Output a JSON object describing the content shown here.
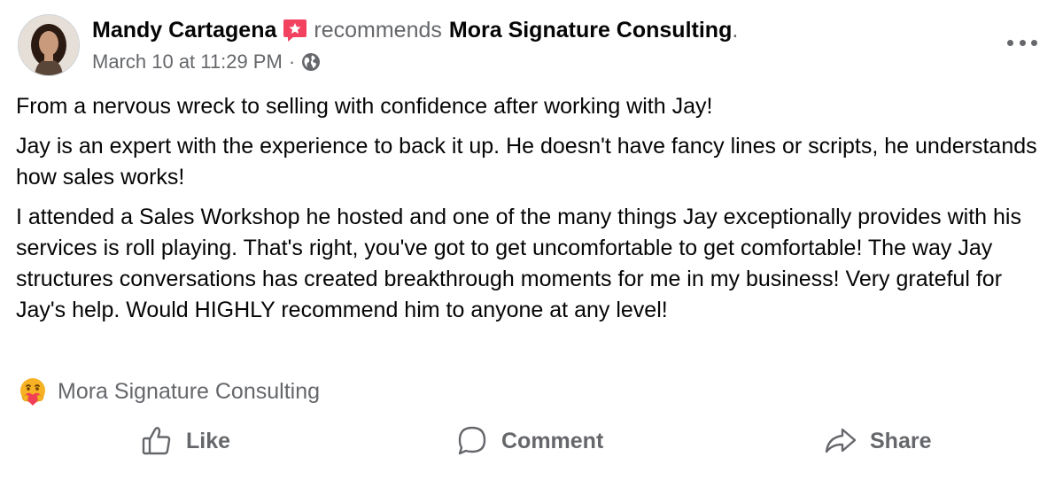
{
  "post": {
    "author": "Mandy Cartagena",
    "action_text": "recommends",
    "page_name": "Mora Signature Consulting",
    "trailing_period": ".",
    "timestamp": "March 10 at 11:29 PM",
    "separator": "·",
    "audience_icon": "globe-icon",
    "paragraphs": [
      "From a nervous wreck to selling with confidence after working with Jay!",
      "Jay is an expert with the experience to back it up. He doesn't have fancy lines or scripts, he understands how sales works!",
      "I attended a Sales Workshop he hosted and one of the many things Jay exceptionally provides with his services is roll playing. That's right, you've got to get uncomfortable to get comfortable! The way Jay structures conversations has created breakthrough moments for me in my business! Very grateful for Jay's help. Would HIGHLY recommend him to anyone at any level!"
    ],
    "tagged_page": {
      "icon": "care-reaction-icon",
      "name": "Mora Signature Consulting"
    }
  },
  "actions": {
    "like_label": "Like",
    "comment_label": "Comment",
    "share_label": "Share"
  },
  "colors": {
    "primary_text": "#050505",
    "secondary_text": "#65676b",
    "recommend_badge": "#f3425f",
    "background": "#ffffff"
  }
}
